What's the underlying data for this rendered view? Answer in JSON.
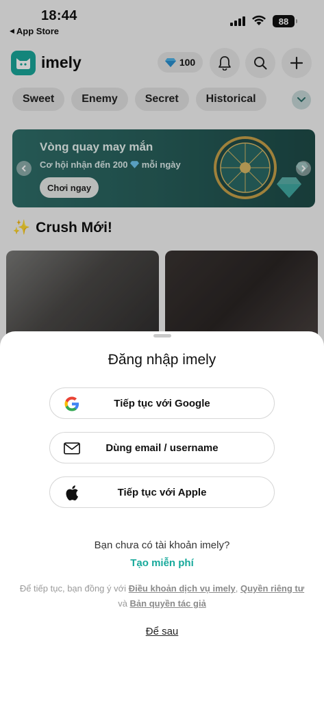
{
  "status_bar": {
    "time": "18:44",
    "back_label": "App Store",
    "battery": "88"
  },
  "header": {
    "app_name": "imely",
    "diamonds": "100"
  },
  "categories": [
    "Sweet",
    "Enemy",
    "Secret",
    "Historical"
  ],
  "banner": {
    "title": "Vòng quay may mắn",
    "subtitle_prefix": "Cơ hội nhận đến 200",
    "subtitle_suffix": "mỗi ngày",
    "cta": "Chơi ngay"
  },
  "section": {
    "emoji": "✨",
    "title": "Crush Mới!"
  },
  "login_sheet": {
    "title": "Đăng nhập imely",
    "google_label": "Tiếp tục với Google",
    "email_label": "Dùng email / username",
    "apple_label": "Tiếp tục với Apple",
    "no_account": "Bạn chưa có tài khoản imely?",
    "create_free": "Tạo miễn phí",
    "terms_prefix": "Để tiếp tục, bạn đồng ý với",
    "terms_link": "Điều khoản dịch vụ imely",
    "privacy_link": "Quyền riêng tư",
    "terms_and": "và",
    "copyright_link": "Bản quyền tác giả",
    "later": "Để sau"
  },
  "colors": {
    "accent": "#17a99b",
    "banner_bg": "#2f6e69"
  }
}
